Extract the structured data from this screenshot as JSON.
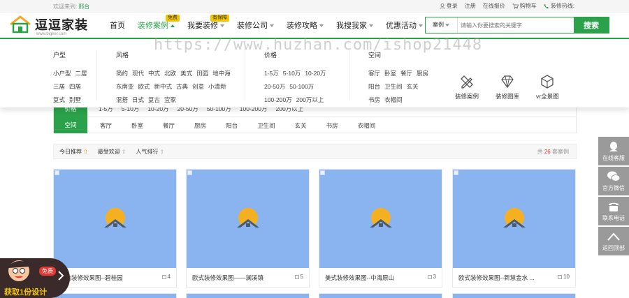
{
  "topbar": {
    "welcome": "欢迎来到:",
    "city": "邢台",
    "login": "登录",
    "register": "注册",
    "quote": "在线报价",
    "cart": "购物车",
    "hotline": "装修热线:"
  },
  "brand": {
    "name": "逗逗家装",
    "url": "www.bigker.com"
  },
  "nav": [
    {
      "label": "首页",
      "tag": "",
      "caret": false,
      "active": false
    },
    {
      "label": "装修案例",
      "tag": "免费",
      "caret": true,
      "active": true
    },
    {
      "label": "我要装修",
      "tag": "有保障",
      "caret": true,
      "active": false
    },
    {
      "label": "装修公司",
      "tag": "",
      "caret": true,
      "active": false
    },
    {
      "label": "装修攻略",
      "tag": "",
      "caret": true,
      "active": false
    },
    {
      "label": "我搜我家",
      "tag": "",
      "caret": true,
      "active": false
    },
    {
      "label": "优惠活动",
      "tag": "",
      "caret": true,
      "active": false
    }
  ],
  "search": {
    "type": "案例",
    "placeholder": "请输入你要搜索的关键字",
    "button": "搜索"
  },
  "mega": {
    "huxing": {
      "title": "户型",
      "rows": [
        [
          "小户型",
          "二居"
        ],
        [
          "三居",
          "四居"
        ],
        [
          "复式",
          "别墅"
        ]
      ]
    },
    "fengge": {
      "title": "风格",
      "rows": [
        [
          "简约",
          "现代",
          "中式",
          "北欧",
          "美式",
          "田园",
          "地中海"
        ],
        [
          "东南亚",
          "欧式",
          "新中式",
          "古典",
          "创意",
          "小清新"
        ],
        [
          "混搭",
          "日式",
          "复古",
          "宜家"
        ]
      ]
    },
    "jiage": {
      "title": "价格",
      "rows": [
        [
          "1-5万",
          "5-10万",
          "10-20万"
        ],
        [
          "20-50万",
          "50-100万"
        ],
        [
          "100-200万",
          "200万以上"
        ]
      ]
    },
    "kongjian": {
      "title": "空间",
      "rows": [
        [
          "客厅",
          "卧室",
          "餐厅",
          "厨房"
        ],
        [
          "阳台",
          "卫生间",
          "玄关"
        ],
        [
          "书房",
          "衣帽间"
        ]
      ]
    },
    "quick": [
      {
        "label": "装修案例",
        "icon": "pencil-ruler-icon"
      },
      {
        "label": "装修图库",
        "icon": "diamond-icon"
      },
      {
        "label": "vr全景图",
        "icon": "cube-icon"
      }
    ]
  },
  "filters": {
    "price": {
      "label": "价格",
      "options": [
        "1-5万",
        "5-10万",
        "10-20万",
        "20-50万",
        "50-100万",
        "100-200万",
        "200万以上"
      ]
    },
    "space": {
      "label": "空间",
      "options": [
        "客厅",
        "卧室",
        "餐厅",
        "厨房",
        "阳台",
        "卫生间",
        "玄关",
        "书房",
        "衣帽间"
      ]
    }
  },
  "sort": {
    "options": [
      {
        "label": "今日推荐",
        "active": true
      },
      {
        "label": "最受欢迎",
        "active": false
      },
      {
        "label": "人气排行",
        "active": false
      }
    ],
    "total_prefix": "共",
    "total_count": "26",
    "total_suffix": "套案例"
  },
  "cards": [
    {
      "title": "简约装修效果图--碧桂园",
      "count": "4"
    },
    {
      "title": "欧式装修效果图——澜溪镇",
      "count": "5"
    },
    {
      "title": "美式装修效果图--中海原山",
      "count": "3"
    },
    {
      "title": "欧式装修效果图--新慧金水 ...",
      "count": "10"
    }
  ],
  "sidebar": [
    {
      "label": "在线客服",
      "icon": "headset-icon"
    },
    {
      "label": "官方微信",
      "icon": "wechat-icon"
    },
    {
      "label": "联系电话",
      "icon": "phone-icon"
    },
    {
      "label": "返回顶部",
      "icon": "chevron-up-icon"
    }
  ],
  "promo": {
    "free": "免费",
    "text": "获取1份设计"
  },
  "watermark": "https://www.huzhan.com/ishop21448",
  "colors": {
    "brand_green": "#2aa14a",
    "image_placeholder": "#8ab4f0",
    "sidebar_gray": "#9a9a9a",
    "tag_yellow": "#f5c400"
  }
}
